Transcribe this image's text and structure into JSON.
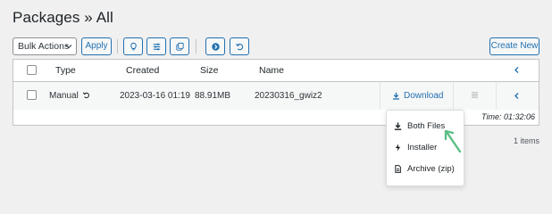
{
  "page": {
    "title": "Packages » All"
  },
  "toolbar": {
    "bulk_actions": "Bulk Actions",
    "apply": "Apply",
    "icons": [
      "lightbulb-icon",
      "sliders-icon",
      "copy-icon",
      "circle-arrow-icon",
      "refresh-icon"
    ],
    "create_new": "Create New"
  },
  "table": {
    "headers": {
      "type": "Type",
      "created": "Created",
      "size": "Size",
      "name": "Name"
    },
    "rows": [
      {
        "type": "Manual",
        "created": "2023-03-16 01:19",
        "size": "88.91MB",
        "name": "20230316_gwiz2",
        "download": "Download"
      }
    ],
    "time": "Time: 01:32:06",
    "items_count": "1 items"
  },
  "download_menu": {
    "items": [
      {
        "label": "Both Files",
        "icon": "download-icon"
      },
      {
        "label": "Installer",
        "icon": "bolt-icon"
      },
      {
        "label": "Archive (zip)",
        "icon": "file-icon"
      }
    ]
  },
  "colors": {
    "accent": "#2271b1",
    "arrow": "#5bbf84",
    "background": "#f0f0f1"
  }
}
